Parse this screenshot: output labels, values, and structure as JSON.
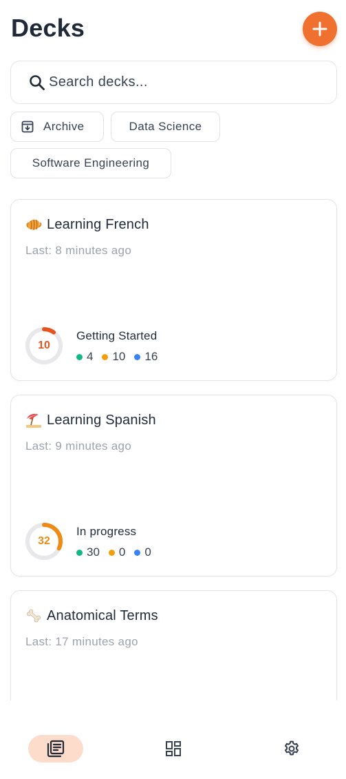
{
  "header": {
    "title": "Decks"
  },
  "search": {
    "placeholder": "Search decks..."
  },
  "chips": [
    {
      "label": "Archive"
    },
    {
      "label": "Data Science"
    },
    {
      "label": "Software Engineering"
    }
  ],
  "decks": [
    {
      "emoji": "croissant",
      "title": "Learning French",
      "last_studied": "Last: 8 minutes ago",
      "progress_value": "10",
      "progress_fraction": 0.1,
      "progress_color": "#e8521f",
      "status": "Getting Started",
      "counts": [
        "4",
        "10",
        "16"
      ]
    },
    {
      "emoji": "beach-umbrella",
      "title": "Learning Spanish",
      "last_studied": "Last: 9 minutes ago",
      "progress_value": "32",
      "progress_fraction": 0.32,
      "progress_color": "#ef8a12",
      "status": "In progress",
      "counts": [
        "30",
        "0",
        "0"
      ]
    },
    {
      "emoji": "bone",
      "title": "Anatomical Terms",
      "last_studied": "Last: 17 minutes ago"
    }
  ],
  "count_colors": {
    "new": "#10b981",
    "learning": "#f59e0b",
    "review": "#3b82f6"
  },
  "colors": {
    "accent": "#f07030",
    "nav_active_bg": "#fddccc"
  },
  "nav": [
    {
      "icon": "decks-icon",
      "active": true
    },
    {
      "icon": "dashboard-grid-icon",
      "active": false
    },
    {
      "icon": "gear-icon",
      "active": false
    }
  ]
}
